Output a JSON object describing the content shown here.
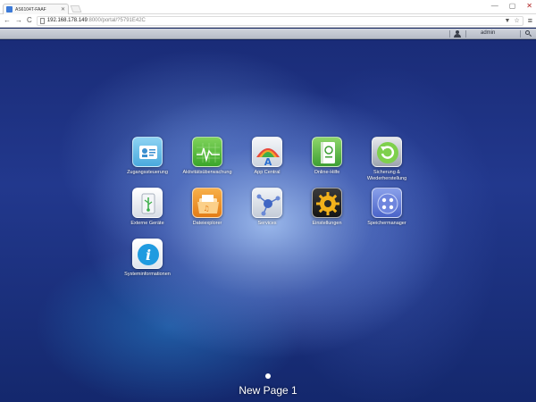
{
  "browser": {
    "tab_title": "AS6104T-FAAF",
    "tab_close": "✕",
    "url_host": "192.168.178.149",
    "url_rest": ":8000/portal/?5791E42C",
    "back": "←",
    "forward": "→",
    "reload": "C",
    "bookmark": "☆",
    "filter": "▼",
    "menu": "≡",
    "win_min": "—",
    "win_max": "▢",
    "win_close": "✕"
  },
  "topbar": {
    "user": "admin"
  },
  "apps": [
    {
      "label": "Zugangssteuerung",
      "icon": "access-control-icon",
      "color": "#6ec3ea"
    },
    {
      "label": "Aktivitätsüberwachung",
      "icon": "activity-monitor-icon",
      "color": "#59c23c"
    },
    {
      "label": "App Central",
      "icon": "app-central-icon",
      "color": "#e9edf3"
    },
    {
      "label": "Online-Hilfe",
      "icon": "online-help-icon",
      "color": "#6cc04b"
    },
    {
      "label": "Sicherung &\nWiederherstellung",
      "icon": "backup-restore-icon",
      "color": "#8fd35a"
    },
    {
      "label": "Externe Geräte",
      "icon": "external-devices-icon",
      "color": "#eef1f5"
    },
    {
      "label": "Dateiexplorer",
      "icon": "file-explorer-icon",
      "color": "#f29a2e"
    },
    {
      "label": "Services",
      "icon": "services-icon",
      "color": "#e5eaf2"
    },
    {
      "label": "Einstellungen",
      "icon": "settings-icon",
      "color": "#2a2a2a"
    },
    {
      "label": "Speichermanager",
      "icon": "storage-manager-icon",
      "color": "#5b78d8"
    },
    {
      "label": "Systeminformationen",
      "icon": "system-info-icon",
      "color": "#1f9be0"
    }
  ],
  "pager": {
    "label": "New Page 1"
  }
}
